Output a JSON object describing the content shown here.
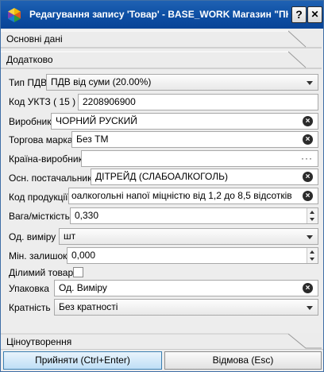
{
  "window": {
    "title": "Редагування запису 'Товар' - BASE_WORK Магазин \"ПК ...",
    "help_label": "?",
    "close_label": "✕"
  },
  "sections": {
    "main": "Основні дані",
    "extra": "Додатково",
    "pricing": "Ціноутворення"
  },
  "form": {
    "vat_type": {
      "label": "Тип ПДВ",
      "value": "ПДВ від суми (20.00%)"
    },
    "uktz": {
      "label": "Код УКТЗ ( 15 )",
      "value": "2208906900"
    },
    "producer": {
      "label": "Виробник",
      "value": "ЧОРНИЙ РУСКИЙ"
    },
    "brand": {
      "label": "Торгова марка",
      "value": "Без ТМ"
    },
    "country": {
      "label": "Країна-виробник",
      "value": ""
    },
    "supplier": {
      "label": "Осн. постачальник",
      "value": "ДІТРЕЙД (СЛАБОАЛКОГОЛЬ)"
    },
    "product_code": {
      "label": "Код продукції",
      "value": "оалкогольні напої міцністю від 1,2 до 8,5 відсотків"
    },
    "weight": {
      "label": "Вага/місткість",
      "value": "0,330"
    },
    "unit": {
      "label": "Од. виміру",
      "value": "шт"
    },
    "min_stock": {
      "label": "Мін. залишок",
      "value": "0,000"
    },
    "divisible": {
      "label": "Ділимий товар",
      "checked": false
    },
    "package": {
      "label": "Упаковка",
      "value": "Од. Виміру"
    },
    "multiplicity": {
      "label": "Кратність",
      "value": "Без кратності"
    }
  },
  "buttons": {
    "accept": "Прийняти (Ctrl+Enter)",
    "cancel": "Відмова (Esc)"
  },
  "icons": {
    "clear": "×",
    "dots": "···"
  }
}
